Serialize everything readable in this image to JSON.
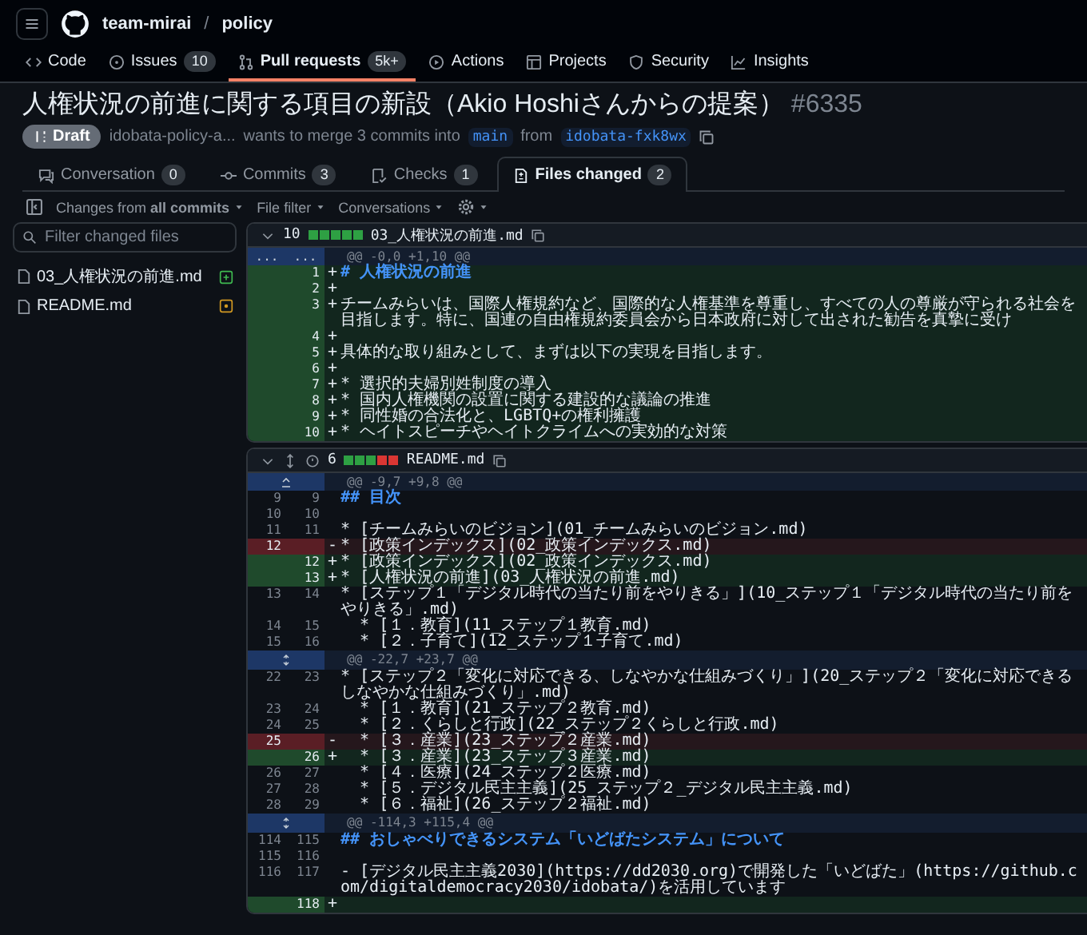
{
  "header": {
    "owner": "team-mirai",
    "separator": "/",
    "repo": "policy"
  },
  "repo_nav": [
    {
      "label": "Code",
      "selected": false
    },
    {
      "label": "Issues",
      "count": "10",
      "selected": false
    },
    {
      "label": "Pull requests",
      "count": "5k+",
      "selected": true
    },
    {
      "label": "Actions",
      "selected": false
    },
    {
      "label": "Projects",
      "selected": false
    },
    {
      "label": "Security",
      "selected": false
    },
    {
      "label": "Insights",
      "selected": false
    }
  ],
  "pr": {
    "title": "人権状況の前進に関する項目の新設（Akio Hoshiさんからの提案）",
    "number": "#6335",
    "badge": "Draft",
    "author": "idobata-policy-a...",
    "merge_text": "wants to merge 3 commits into",
    "base": "main",
    "from": "from",
    "head": "idobata-fxk8wx"
  },
  "tabs": [
    {
      "label": "Conversation",
      "count": "0",
      "selected": false
    },
    {
      "label": "Commits",
      "count": "3",
      "selected": false
    },
    {
      "label": "Checks",
      "count": "1",
      "selected": false
    },
    {
      "label": "Files changed",
      "count": "2",
      "selected": true
    }
  ],
  "toolbar": [
    "Changes from **all commits**",
    "File filter",
    "Conversations"
  ],
  "sidebar": {
    "placeholder": "Filter changed files",
    "files": [
      {
        "name": "03_人権状況の前進.md",
        "kind": "added"
      },
      {
        "name": "README.md",
        "kind": "modified"
      }
    ]
  },
  "files": [
    {
      "count": "10",
      "diffstat": [
        {
          "color": "#2ea043"
        },
        {
          "color": "#2ea043"
        },
        {
          "color": "#2ea043"
        },
        {
          "color": "#2ea043"
        },
        {
          "color": "#2ea043"
        }
      ],
      "name": "03_人権状況の前進.md",
      "extra_icons": false,
      "blocks": [
        {
          "hunk": "@@ -0,0 +1,10 @@",
          "kind": "ellipsis",
          "old": "...",
          "new": "...",
          "lines": [
            {
              "new": "1",
              "kind": "add-heading",
              "sign": "+",
              "text": "# 人権状況の前進"
            },
            {
              "new": "2",
              "kind": "add",
              "sign": "+"
            },
            {
              "new": "3",
              "kind": "add",
              "sign": "+",
              "text": "チームみらいは、国際人権規約など、国際的な人権基準を尊重し、すべての人の尊厳が守られる社会を目指します。特に、国連の自由権規約委員会から日本政府に対して出された勧告を真摯に受け"
            },
            {
              "new": "4",
              "kind": "add",
              "sign": "+"
            },
            {
              "new": "5",
              "kind": "add",
              "sign": "+",
              "text": "具体的な取り組みとして、まずは以下の実現を目指します。"
            },
            {
              "new": "6",
              "kind": "add",
              "sign": "+"
            },
            {
              "new": "7",
              "kind": "add",
              "sign": "+",
              "text": "* 選択的夫婦別姓制度の導入"
            },
            {
              "new": "8",
              "kind": "add",
              "sign": "+",
              "text": "* 国内人権機関の設置に関する建設的な議論の推進"
            },
            {
              "new": "9",
              "kind": "add",
              "sign": "+",
              "text": "* 同性婚の合法化と、LGBTQ+の権利擁護"
            },
            {
              "new": "10",
              "kind": "add",
              "sign": "+",
              "text": "* ヘイトスピーチやヘイトクライムへの実効的な対策"
            }
          ]
        }
      ]
    },
    {
      "count": "6",
      "diffstat": [
        {
          "color": "#2ea043"
        },
        {
          "color": "#2ea043"
        },
        {
          "color": "#2ea043"
        },
        {
          "color": "#da3633"
        },
        {
          "color": "#da3633"
        }
      ],
      "name": "README.md",
      "extra_icons": true,
      "blocks": [
        {
          "hunk": "@@ -9,7 +9,8 @@",
          "kind": "expand-up",
          "lines": [
            {
              "old": "9",
              "new": "9",
              "kind": "context-heading",
              "text": "## 目次"
            },
            {
              "old": "10",
              "new": "10",
              "kind": "context"
            },
            {
              "old": "11",
              "new": "11",
              "kind": "context",
              "text": "* [チームみらいのビジョン](01_チームみらいのビジョン.md)"
            },
            {
              "old": "12",
              "kind": "del",
              "sign": "-",
              "text": "* [政策インデックス](02_政策インデックス.md)"
            },
            {
              "new": "12",
              "kind": "add",
              "sign": "+",
              "text": "* [政策インデックス](02_政策インデックス.md)"
            },
            {
              "new": "13",
              "kind": "add",
              "sign": "+",
              "text": "* [人権状況の前進](03_人権状況の前進.md)"
            },
            {
              "old": "13",
              "new": "14",
              "kind": "context",
              "text": "* [ステップ１「デジタル時代の当たり前をやりきる」](10_ステップ１「デジタル時代の当たり前をやりきる」.md)"
            },
            {
              "old": "14",
              "new": "15",
              "kind": "context",
              "text": "  * [１．教育](11_ステップ１教育.md)"
            },
            {
              "old": "15",
              "new": "16",
              "kind": "context",
              "text": "  * [２．子育て](12_ステップ１子育て.md)"
            }
          ]
        },
        {
          "hunk": "@@ -22,7 +23,7 @@",
          "kind": "expand-both",
          "lines": [
            {
              "old": "22",
              "new": "23",
              "kind": "context",
              "text": "* [ステップ２「変化に対応できる、しなやかな仕組みづくり」](20_ステップ２「変化に対応できるしなやかな仕組みづくり」.md)"
            },
            {
              "old": "23",
              "new": "24",
              "kind": "context",
              "text": "  * [１．教育](21_ステップ２教育.md)"
            },
            {
              "old": "24",
              "new": "25",
              "kind": "context",
              "text": "  * [２．くらしと行政](22_ステップ２くらしと行政.md)"
            },
            {
              "old": "25",
              "kind": "del",
              "sign": "-",
              "text": "  * [３．産業](23_ステップ２産業.md)"
            },
            {
              "new": "26",
              "kind": "add",
              "sign": "+",
              "text": "  * [３．産業](23_ステップ３産業.md)"
            },
            {
              "old": "26",
              "new": "27",
              "kind": "context",
              "text": "  * [４．医療](24_ステップ２医療.md)"
            },
            {
              "old": "27",
              "new": "28",
              "kind": "context",
              "text": "  * [５．デジタル民主主義](25_ステップ２_デジタル民主主義.md)"
            },
            {
              "old": "28",
              "new": "29",
              "kind": "context",
              "text": "  * [６．福祉](26_ステップ２福祉.md)"
            }
          ]
        },
        {
          "hunk": "@@ -114,3 +115,4 @@",
          "kind": "expand-both",
          "lines": [
            {
              "old": "114",
              "new": "115",
              "kind": "context-heading",
              "text": "## おしゃべりできるシステム「いどばたシステム」について"
            },
            {
              "old": "115",
              "new": "116",
              "kind": "context"
            },
            {
              "old": "116",
              "new": "117",
              "kind": "context",
              "text": "- [デジタル民主主義2030](https://dd2030.org)で開発した「いどばた」(https://github.com/digitaldemocracy2030/idobata/)を活用しています"
            },
            {
              "new": "118",
              "kind": "add",
              "sign": "+"
            }
          ]
        }
      ]
    }
  ]
}
